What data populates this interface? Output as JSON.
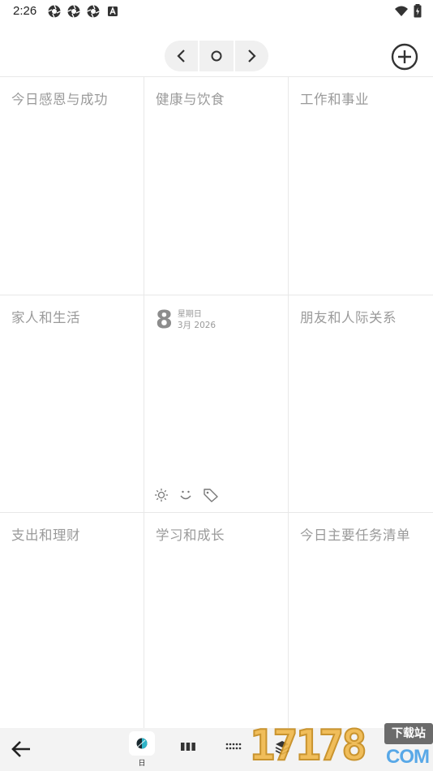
{
  "status_bar": {
    "time": "2:26",
    "notification_icons": [
      "aperture-icon",
      "aperture-icon",
      "aperture-icon",
      "a-box-icon"
    ],
    "right_icons": [
      "wifi-icon",
      "battery-charging-icon"
    ]
  },
  "nav": {
    "prev": "‹",
    "today": "○",
    "next": "›",
    "add_icon": "plus-circle-icon"
  },
  "grid": {
    "cells": [
      {
        "title": "今日感恩与成功"
      },
      {
        "title": "健康与饮食"
      },
      {
        "title": "工作和事业"
      },
      {
        "title": "家人和生活"
      },
      {
        "title": ""
      },
      {
        "title": "朋友和人际关系"
      },
      {
        "title": "支出和理财"
      },
      {
        "title": "学习和成长"
      },
      {
        "title": "今日主要任务清单"
      }
    ],
    "center": {
      "day": "8",
      "weekday": "星期日",
      "month_year": "3月 2026",
      "icons": [
        "sun-icon",
        "smile-icon",
        "tag-icon"
      ]
    }
  },
  "bottom_bar": {
    "back_icon": "arrow-left-icon",
    "tabs": [
      {
        "icon": "day-circle-icon",
        "label": "日",
        "active": true
      },
      {
        "icon": "columns-icon",
        "label": ""
      },
      {
        "icon": "dots-grid-icon",
        "label": ""
      },
      {
        "icon": "layers-icon",
        "label": ""
      }
    ]
  },
  "watermark": {
    "number": "17178",
    "badge": "下载站",
    "domain": "COM"
  }
}
